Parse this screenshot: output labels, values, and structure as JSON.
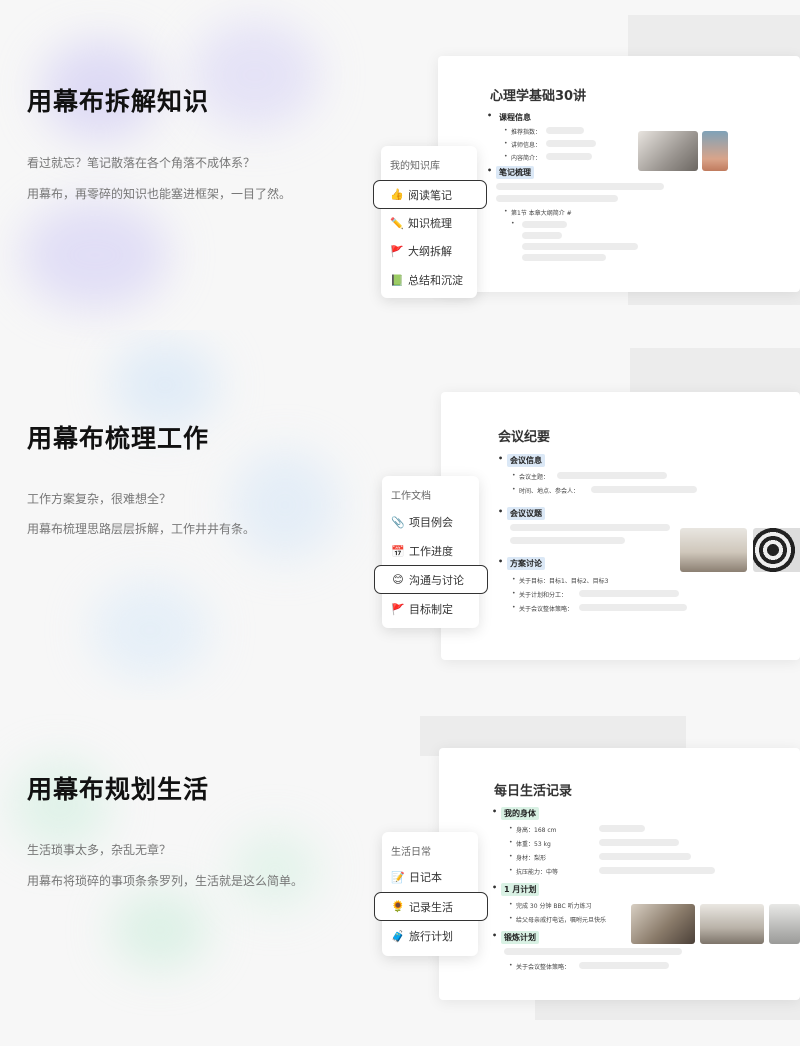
{
  "sections": [
    {
      "title": "用幕布拆解知识",
      "desc1": "看过就忘？笔记散落在各个角落不成体系？",
      "desc2": "用幕布，再零碎的知识也能塞进框架，一目了然。",
      "menu": {
        "header": "我的知识库",
        "items": [
          {
            "icon": "👍",
            "label": "阅读笔记",
            "active": true
          },
          {
            "icon": "✏️",
            "label": "知识梳理"
          },
          {
            "icon": "🚩",
            "label": "大纲拆解"
          },
          {
            "icon": "📗",
            "label": "总结和沉淀"
          }
        ]
      },
      "doc": {
        "title": "心理学基础30讲",
        "h1": "课程信息",
        "lines": [
          "推荐指数：",
          "讲师信息：",
          "内容简介："
        ],
        "h2": "笔记梳理",
        "sub": "第1节  本章大纲简介",
        "sub_tag": "#"
      }
    },
    {
      "title": "用幕布梳理工作",
      "desc1": "工作方案复杂，很难想全？",
      "desc2": "用幕布梳理思路层层拆解，工作井井有条。",
      "menu": {
        "header": "工作文档",
        "items": [
          {
            "icon": "📎",
            "label": "项目例会"
          },
          {
            "icon": "📅",
            "label": "工作进度"
          },
          {
            "icon": "😊",
            "label": "沟通与讨论",
            "active": true
          },
          {
            "icon": "🚩",
            "label": "目标制定"
          }
        ]
      },
      "doc": {
        "title": "会议纪要",
        "h1": "会议信息",
        "h1_lines": [
          "会议主题：",
          "时间、地点、参会人："
        ],
        "h2": "会议议题",
        "h3": "方案讨论",
        "h3_lines": [
          "关于目标：目标1、目标2、目标3",
          "关于计划和分工：",
          "关于会议整体策略："
        ]
      }
    },
    {
      "title": "用幕布规划生活",
      "desc1": "生活琐事太多，杂乱无章？",
      "desc2": "用幕布将琐碎的事项条条罗列，生活就是这么简单。",
      "menu": {
        "header": "生活日常",
        "items": [
          {
            "icon": "📝",
            "label": "日记本"
          },
          {
            "icon": "🌻",
            "label": "记录生活",
            "active": true
          },
          {
            "icon": "🧳",
            "label": "旅行计划"
          }
        ]
      },
      "doc": {
        "title": "每日生活记录",
        "h1": "我的身体",
        "h1_lines": [
          "身高：168 cm",
          "体重：53 kg",
          "身材：梨形",
          "抗压能力：中等"
        ],
        "h2": "1 月计划",
        "h2_lines": [
          "完成 30 分钟 BBC 听力练习",
          "给父母亲戚打电话，嘱咐元旦快乐"
        ],
        "h3": "锻炼计划",
        "h3_lines": [
          "关于会议整体策略："
        ]
      }
    }
  ]
}
